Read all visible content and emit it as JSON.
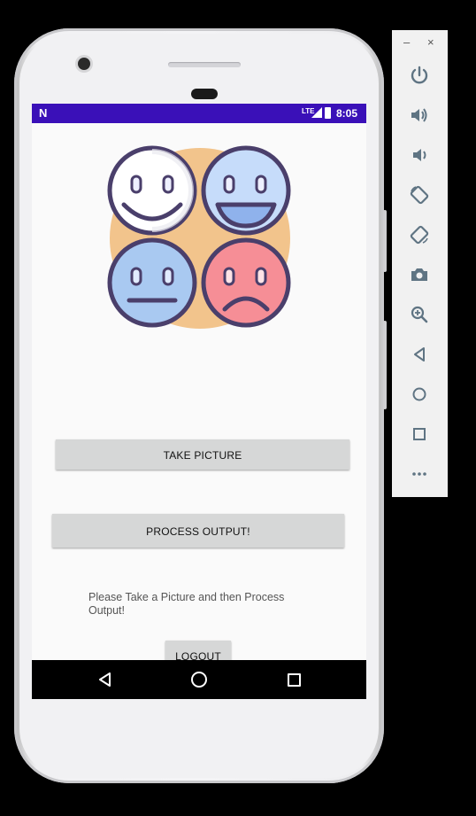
{
  "statusbar": {
    "notification_icon": "N",
    "network_label": "LTE",
    "time": "8:05"
  },
  "hero": {
    "image_name": "emotion-faces-illustration",
    "colors": {
      "blob": "#f2c48c",
      "face_white": "#ffffff",
      "face_blue_light": "#c6dcfa",
      "face_blue": "#a9c9f1",
      "face_pink": "#f68e96",
      "outline": "#4a3f6b"
    }
  },
  "buttons": {
    "take_picture": "TAKE PICTURE",
    "process_output": "PROCESS OUTPUT!",
    "logout": "LOGOUT"
  },
  "message": "Please Take a Picture and then Process Output!",
  "navigation": {
    "back": "back-icon",
    "home": "home-icon",
    "recents": "recents-icon"
  },
  "emulator_toolbar": {
    "minimize": "–",
    "close": "×",
    "items": [
      "power-icon",
      "volume-up-icon",
      "volume-down-icon",
      "rotate-left-icon",
      "rotate-right-icon",
      "camera-icon",
      "zoom-icon",
      "back-icon",
      "home-icon",
      "overview-icon",
      "more-icon"
    ]
  },
  "accent_colors": {
    "status_bar": "#3a10b8",
    "button_bg": "#d6d7d7"
  }
}
